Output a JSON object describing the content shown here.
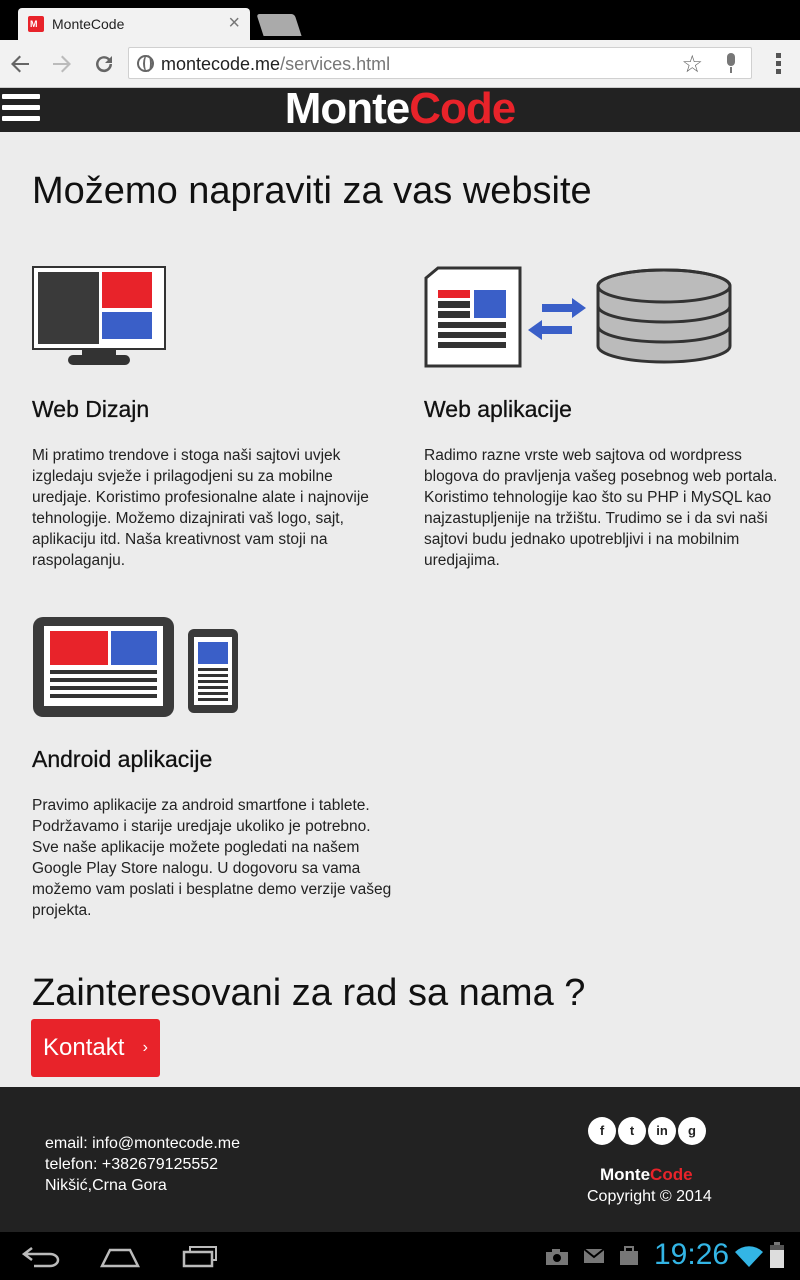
{
  "browser": {
    "tab_title": "MonteCode",
    "tab_close": "×",
    "url_host": "montecode.me",
    "url_path": "/services.html"
  },
  "site": {
    "logo_part1": "Monte",
    "logo_part2": "Code",
    "page_title": "Možemo napraviti za vas website",
    "services": [
      {
        "title": "Web Dizajn",
        "text": "Mi pratimo trendove i stoga naši sajtovi uvjek izgledaju svježe i prilagodjeni su za mobilne uredjaje. Koristimo profesionalne alate i najnovije tehnologije. Možemo dizajnirati vaš logo, sajt, aplikaciju itd. Naša kreativnost vam stoji na raspolaganju."
      },
      {
        "title": "Web aplikacije",
        "text": "Radimo razne vrste web sajtova od wordpress blogova do pravljenja vašeg posebnog web portala. Koristimo tehnologije kao što su PHP i MySQL kao najzastupljenije na tržištu. Trudimo se i da svi naši sajtovi budu jednako upotrebljivi i na mobilnim uredjajima."
      },
      {
        "title": "Android aplikacije",
        "text": "Pravimo aplikacije za android smartfone i tablete. Podržavamo i starije uredjaje ukoliko je potrebno. Sve naše aplikacije možete pogledati na našem Google Play Store nalogu. U dogovoru sa vama možemo vam poslati i besplatne demo verzije vašeg projekta."
      }
    ],
    "cta_title": "Zainteresovani za rad sa nama ?",
    "cta_button": "Kontakt",
    "cta_chevron": "›"
  },
  "footer": {
    "email": "email: info@montecode.me",
    "phone": "telefon: +382679125552",
    "address": "Nikšić,Crna Gora",
    "social": [
      "f",
      "t",
      "in",
      "g"
    ],
    "logo_part1": "Monte",
    "logo_part2": "Code",
    "copyright": "Copyright © 2014"
  },
  "system": {
    "clock": "19:26"
  },
  "colors": {
    "brand_red": "#e8232a",
    "brand_blue": "#3a5fc8",
    "dark": "#222222"
  }
}
